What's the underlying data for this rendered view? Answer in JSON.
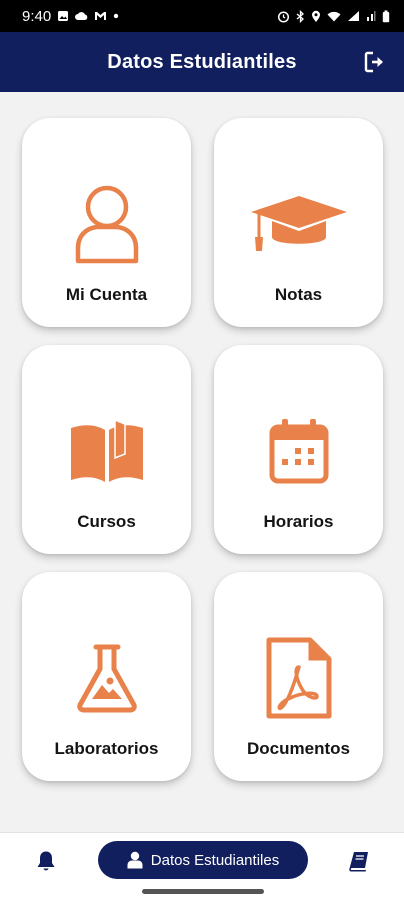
{
  "status_bar": {
    "time": "9:40"
  },
  "header": {
    "title": "Datos Estudiantiles",
    "logout_icon": "logout-icon"
  },
  "colors": {
    "primary": "#121f5e",
    "accent": "#e8824a",
    "background": "#f2f2f2"
  },
  "menu": {
    "items": [
      {
        "label": "Mi Cuenta",
        "icon": "user-icon"
      },
      {
        "label": "Notas",
        "icon": "graduation-cap-icon"
      },
      {
        "label": "Cursos",
        "icon": "open-book-icon"
      },
      {
        "label": "Horarios",
        "icon": "calendar-icon"
      },
      {
        "label": "Laboratorios",
        "icon": "flask-icon"
      },
      {
        "label": "Documentos",
        "icon": "pdf-document-icon"
      }
    ]
  },
  "bottom_nav": {
    "left_icon": "bell-icon",
    "active_label": "Datos Estudiantiles",
    "active_icon": "user-icon",
    "right_icon": "book-icon"
  }
}
